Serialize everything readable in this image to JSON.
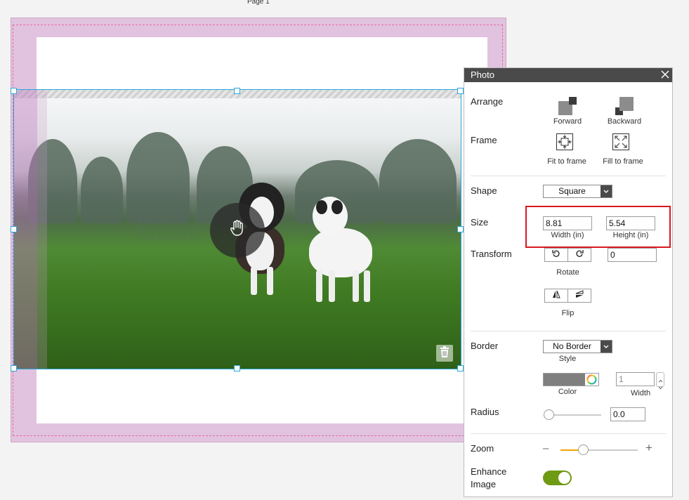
{
  "canvas": {
    "page_label": "Page 1"
  },
  "panel": {
    "title": "Photo",
    "arrange": {
      "label": "Arrange",
      "forward": "Forward",
      "backward": "Backward"
    },
    "frame": {
      "label": "Frame",
      "fit": "Fit to frame",
      "fill": "Fill to frame"
    },
    "shape": {
      "label": "Shape",
      "value": "Square"
    },
    "size": {
      "label": "Size",
      "width_value": "8.81",
      "width_label": "Width (in)",
      "height_value": "5.54",
      "height_label": "Height (in)"
    },
    "transform": {
      "label": "Transform",
      "rotate_label": "Rotate",
      "rotate_value": "0",
      "flip_label": "Flip"
    },
    "border": {
      "label": "Border",
      "style_value": "No Border",
      "style_label": "Style",
      "color_label": "Color",
      "width_value": "1",
      "width_label": "Width",
      "color": "#7f7f7f"
    },
    "radius": {
      "label": "Radius",
      "value": "0.0"
    },
    "zoom": {
      "label": "Zoom",
      "minus": "–",
      "plus": "+",
      "level": 0.29
    },
    "enhance": {
      "label_line1": "Enhance",
      "label_line2": "Image",
      "on": true
    }
  },
  "colors": {
    "selection": "#2aa7d8",
    "highlight": "#d9181f",
    "toggle_on": "#6f9a14",
    "slider_fill": "#f0a500"
  }
}
